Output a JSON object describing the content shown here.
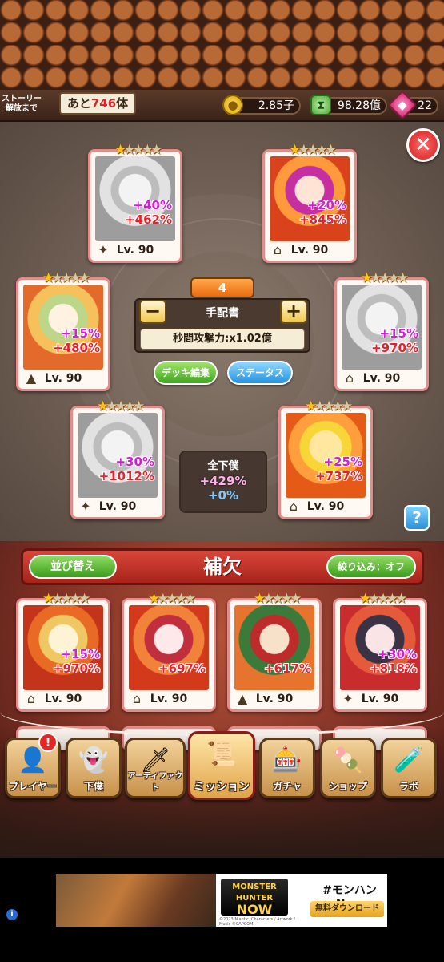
{
  "status": {
    "story_label_line1": "ストーリー",
    "story_label_line2": "解放まで",
    "remaining_prefix": "あと",
    "remaining_count": "746",
    "remaining_suffix": "体",
    "coins": "2.85子",
    "time_resource": "98.28億",
    "gems": "22"
  },
  "team": {
    "cards": [
      {
        "stars_filled": "★",
        "stars_empty": "★★★★",
        "boost_pink": "+40%",
        "boost_red": "+462%",
        "level": "Lv. 90",
        "icon": "shuriken-icon"
      },
      {
        "stars_filled": "★",
        "stars_empty": "★★★★",
        "boost_pink": "+20%",
        "boost_red": "+845%",
        "level": "Lv. 90",
        "icon": "temple-icon"
      },
      {
        "stars_filled": "★",
        "stars_empty": "★★★★",
        "boost_pink": "+15%",
        "boost_red": "+480%",
        "level": "Lv. 90",
        "icon": "eye-triangle-icon"
      },
      {
        "stars_filled": "★",
        "stars_empty": "★★★★",
        "boost_pink": "+15%",
        "boost_red": "+970%",
        "level": "Lv. 90",
        "icon": "temple-icon"
      },
      {
        "stars_filled": "★",
        "stars_empty": "★★★★",
        "boost_pink": "+30%",
        "boost_red": "+1012%",
        "level": "Lv. 90",
        "icon": "shuriken-icon"
      },
      {
        "stars_filled": "★",
        "stars_empty": "★★★★",
        "boost_pink": "+25%",
        "boost_red": "+737%",
        "level": "Lv. 90",
        "icon": "temple-icon"
      }
    ],
    "deck_number": "4",
    "deck_name": "手配書",
    "minus_label": "−",
    "plus_label": "+",
    "attack_stat": "秒間攻撃力:x1.02億",
    "deck_edit_label": "デッキ編集",
    "status_label": "ステータス",
    "all_title": "全下僕",
    "all_value_1": "+429%",
    "all_value_2": "+0%",
    "close_label": "✕",
    "help_label": "?"
  },
  "reserve": {
    "sort_label": "並び替え",
    "title": "補欠",
    "filter_label": "絞り込み：オフ",
    "cards": [
      {
        "stars_filled": "★",
        "stars_empty": "★★★★",
        "boost_pink": "+15%",
        "boost_red": "+970%",
        "level": "Lv. 90",
        "icon": "temple-icon"
      },
      {
        "stars_filled": "★",
        "stars_empty": "★★★★",
        "boost_pink": "",
        "boost_red": "+697%",
        "level": "Lv. 90",
        "icon": "temple-icon"
      },
      {
        "stars_filled": "★",
        "stars_empty": "★★★★",
        "boost_pink": "",
        "boost_red": "+617%",
        "level": "Lv. 90",
        "icon": "eye-triangle-icon"
      },
      {
        "stars_filled": "★",
        "stars_empty": "★★★★",
        "boost_pink": "+30%",
        "boost_red": "+818%",
        "level": "Lv. 90",
        "icon": "shuriken-icon"
      }
    ]
  },
  "nav": {
    "alert_mark": "!",
    "items": [
      {
        "label": "プレイヤー",
        "icon": "player-icon"
      },
      {
        "label": "下僕",
        "icon": "minion-icon"
      },
      {
        "label": "アーティファクト",
        "icon": "artifact-icon"
      },
      {
        "label": "ミッション",
        "icon": "mission-icon"
      },
      {
        "label": "ガチャ",
        "icon": "gacha-icon"
      },
      {
        "label": "ショップ",
        "icon": "shop-icon"
      },
      {
        "label": "ラボ",
        "icon": "lab-icon"
      }
    ]
  },
  "ad": {
    "info_mark": "i",
    "logo_line1": "MONSTER HUNTER",
    "logo_line2": "NOW",
    "copyright": "©2023 Niantic, Characters / Artwork / Music ©CAPCOM",
    "title": "#モンハンNow",
    "cta": "無料ダウンロード"
  }
}
